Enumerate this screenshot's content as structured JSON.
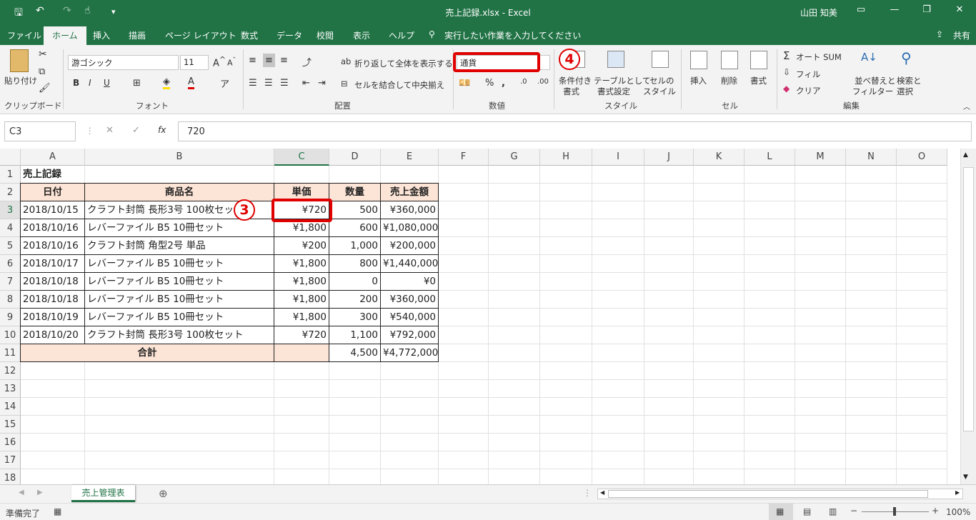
{
  "window": {
    "title": "売上記録.xlsx  -  Excel",
    "user": "山田 知美"
  },
  "tabs": [
    "ファイル",
    "ホーム",
    "挿入",
    "描画",
    "ページ レイアウト",
    "数式",
    "データ",
    "校閲",
    "表示",
    "ヘルプ"
  ],
  "tell_me": "実行したい作業を入力してください",
  "share": "共有",
  "ribbon": {
    "paste": "貼り付け",
    "font_name": "游ゴシック",
    "font_size": "11",
    "wrap_text": "折り返して全体を表示する",
    "merge_center": "セルを結合して中央揃え",
    "number_format": "通貨",
    "cond_format": [
      "条件付き",
      "書式"
    ],
    "format_table": [
      "テーブルとして",
      "書式設定"
    ],
    "cell_styles": [
      "セルの",
      "スタイル"
    ],
    "insert": "挿入",
    "delete": "削除",
    "format": "書式",
    "autosum": "オート SUM",
    "fill": "フィル",
    "clear": "クリア",
    "sort_filter": [
      "並べ替えと",
      "フィルター"
    ],
    "find_select": [
      "検索と",
      "選択"
    ],
    "groups": [
      "クリップボード",
      "フォント",
      "配置",
      "数値",
      "スタイル",
      "セル",
      "編集"
    ]
  },
  "formula_bar": {
    "name_box": "C3",
    "fx": "fx",
    "value": "720"
  },
  "columns": [
    "A",
    "B",
    "C",
    "D",
    "E",
    "F",
    "G",
    "H",
    "I",
    "J",
    "K",
    "L",
    "M",
    "N",
    "O"
  ],
  "rows": [
    "1",
    "2",
    "3",
    "4",
    "5",
    "6",
    "7",
    "8",
    "9",
    "10",
    "11",
    "12",
    "13",
    "14",
    "15",
    "16",
    "17",
    "18"
  ],
  "sheet": {
    "title": "売上記録",
    "headers": [
      "日付",
      "商品名",
      "単価",
      "数量",
      "売上金額"
    ],
    "data": [
      [
        "2018/10/15",
        "クラフト封筒 長形3号 100枚セット",
        "¥720",
        "500",
        "¥360,000"
      ],
      [
        "2018/10/16",
        "レバーファイル B5 10冊セット",
        "¥1,800",
        "600",
        "¥1,080,000"
      ],
      [
        "2018/10/16",
        "クラフト封筒 角型2号 単品",
        "¥200",
        "1,000",
        "¥200,000"
      ],
      [
        "2018/10/17",
        "レバーファイル B5 10冊セット",
        "¥1,800",
        "800",
        "¥1,440,000"
      ],
      [
        "2018/10/18",
        "レバーファイル B5 10冊セット",
        "¥1,800",
        "0",
        "¥0"
      ],
      [
        "2018/10/18",
        "レバーファイル B5 10冊セット",
        "¥1,800",
        "200",
        "¥360,000"
      ],
      [
        "2018/10/19",
        "レバーファイル B5 10冊セット",
        "¥1,800",
        "300",
        "¥540,000"
      ],
      [
        "2018/10/20",
        "クラフト封筒 長形3号 100枚セット",
        "¥720",
        "1,100",
        "¥792,000"
      ]
    ],
    "total_label": "合計",
    "total_qty": "4,500",
    "total_amount": "¥4,772,000"
  },
  "annotations": {
    "step3": "3",
    "step4": "4"
  },
  "sheet_tab": "売上管理表",
  "status": {
    "ready": "準備完了",
    "zoom": "100%"
  }
}
